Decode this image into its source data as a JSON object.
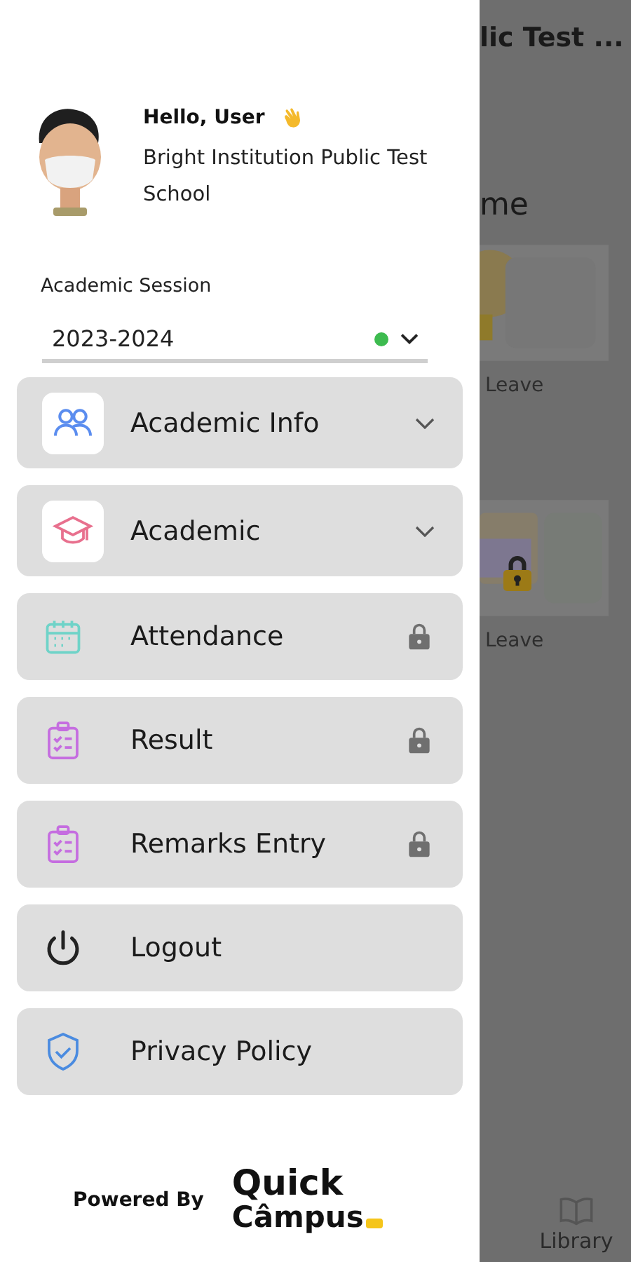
{
  "drawer": {
    "greeting": "Hello, User",
    "school": "Bright Institution Public Test School",
    "session": {
      "label": "Academic Session",
      "value": "2023-2024",
      "active": true
    },
    "menu": [
      {
        "label": "Academic Info",
        "kind": "people",
        "tile": true,
        "expandable": true,
        "locked": false
      },
      {
        "label": "Academic",
        "kind": "cap",
        "tile": true,
        "expandable": true,
        "locked": false
      },
      {
        "label": "Attendance",
        "kind": "calendar",
        "tile": false,
        "expandable": false,
        "locked": true
      },
      {
        "label": "Result",
        "kind": "clipboard",
        "tile": false,
        "expandable": false,
        "locked": true
      },
      {
        "label": "Remarks Entry",
        "kind": "clipboard",
        "tile": false,
        "expandable": false,
        "locked": true
      },
      {
        "label": "Logout",
        "kind": "power",
        "tile": false,
        "expandable": false,
        "locked": false
      },
      {
        "label": "Privacy Policy",
        "kind": "shield",
        "tile": false,
        "expandable": false,
        "locked": false
      }
    ],
    "powered_by": "Powered By",
    "logo": {
      "line_1": "Quick",
      "line_2": "Câmpus"
    }
  },
  "background": {
    "title": "lic Test ...",
    "heading": "me",
    "cards": [
      {
        "label": "Leave",
        "locked": false
      },
      {
        "label": "Leave",
        "locked": true
      }
    ],
    "nav_item": "Library"
  }
}
